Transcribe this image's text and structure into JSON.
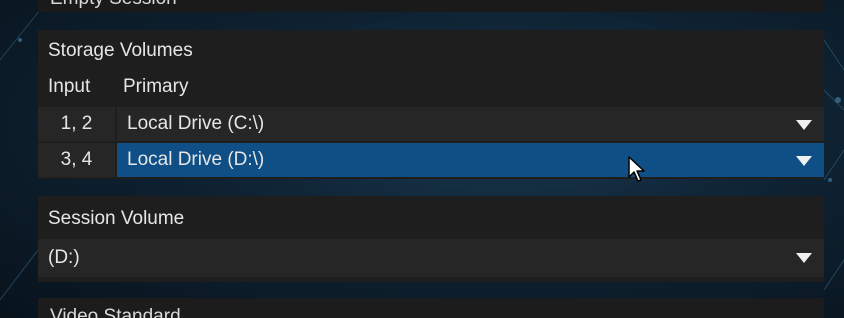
{
  "empty_session_label": "Empty Session",
  "storage_volumes": {
    "title": "Storage Volumes",
    "col_input": "Input",
    "col_primary": "Primary",
    "rows": [
      {
        "input": "1, 2",
        "primary": "Local Drive (C:\\)",
        "selected": false
      },
      {
        "input": "3, 4",
        "primary": "Local Drive (D:\\)",
        "selected": true
      }
    ]
  },
  "session_volume": {
    "title": "Session Volume",
    "value": "(D:)"
  },
  "video_standard_label": "Video Standard",
  "icons": {
    "dropdown": "chevron-down-icon",
    "cursor": "mouse-pointer-icon"
  },
  "colors": {
    "selected_row": "#0f4f85",
    "panel": "#1e1e1e"
  }
}
